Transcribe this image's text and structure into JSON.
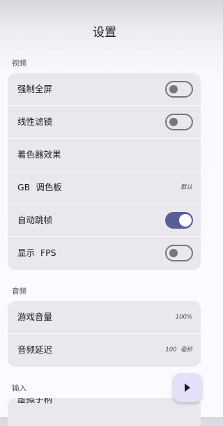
{
  "header": {
    "title": "设置"
  },
  "sections": {
    "video": {
      "label": "视频",
      "rows": [
        {
          "label": "强制全屏",
          "toggle": false
        },
        {
          "label": "线性滤镜",
          "toggle": false
        },
        {
          "label": "着色器效果"
        },
        {
          "label": "GB  调色板",
          "value": "默认"
        },
        {
          "label": "自动跳帧",
          "toggle": true
        },
        {
          "label": "显示  FPS",
          "toggle": false
        }
      ]
    },
    "audio": {
      "label": "音频",
      "rows": [
        {
          "label": "游戏音量",
          "value": "100%"
        },
        {
          "label": "音频延迟",
          "value": "100  毫秒"
        }
      ]
    },
    "input": {
      "label": "输入",
      "rows": [
        {
          "label": "虚拟手柄"
        }
      ]
    }
  },
  "fab": {
    "icon": "play-icon"
  },
  "colors": {
    "accent": "#5b5e96",
    "card": "#eae8ee",
    "background": "#fcfaff"
  }
}
